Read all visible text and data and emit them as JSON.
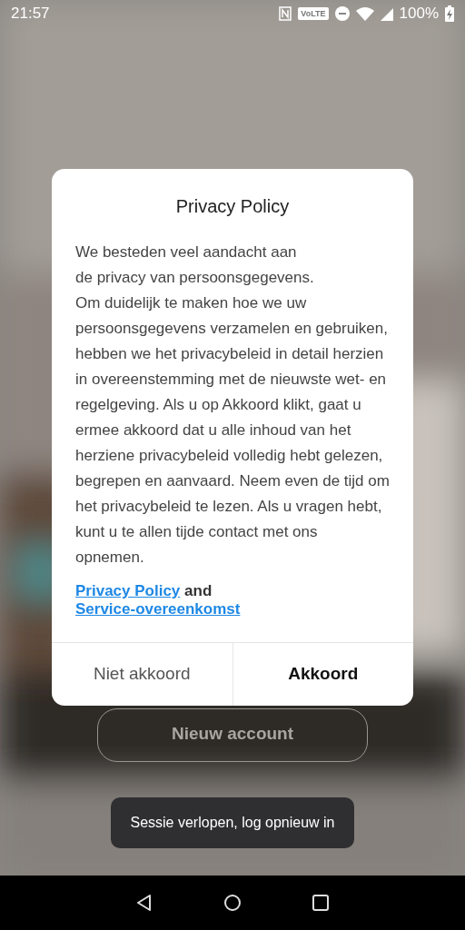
{
  "status_bar": {
    "time": "21:57",
    "volte": "VoLTE",
    "battery": "100%"
  },
  "background": {
    "button": "Nieuw account"
  },
  "dialog": {
    "title": "Privacy Policy",
    "body": "We besteden veel aandacht aan\nde privacy van persoonsgegevens.\nOm duidelijk te maken hoe we uw persoonsgegevens verzamelen en gebruiken, hebben we het privacybeleid in detail herzien in overeenstemming met de nieuwste wet- en regelgeving. Als u op Akkoord klikt, gaat u ermee akkoord dat u alle inhoud van het herziene privacybeleid volledig hebt gelezen, begrepen en aanvaard. Neem even de tijd om het privacybeleid te lezen. Als u vragen hebt, kunt u te allen tijde contact met ons opnemen.",
    "links": {
      "first": "Privacy Policy",
      "joiner": "and",
      "second": "Service-overeenkomst"
    },
    "buttons": [
      {
        "label": "Niet akkoord",
        "kind": "secondary"
      },
      {
        "label": "Akkoord",
        "kind": "primary"
      }
    ]
  },
  "toast": "Sessie verlopen, log opnieuw in"
}
